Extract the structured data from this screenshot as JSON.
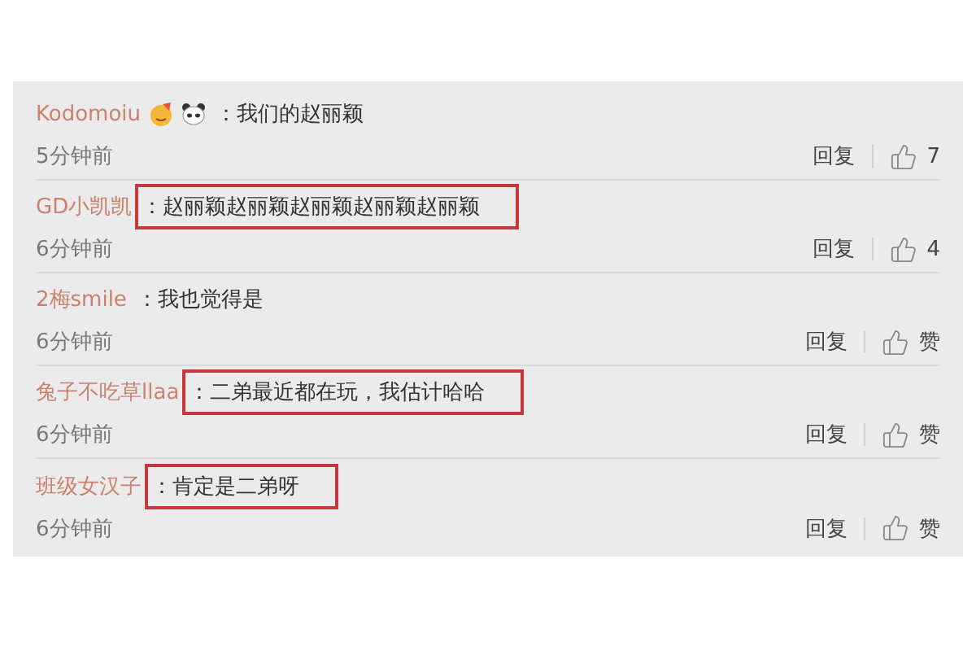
{
  "comments": [
    {
      "user": "Kodomoiu",
      "emoji": [
        {
          "kind": "face"
        },
        {
          "kind": "panda"
        }
      ],
      "text": "：我们的赵丽颖",
      "highlighted": false,
      "time": "5分钟前",
      "reply": "回复",
      "like": "7"
    },
    {
      "user": "GD小凯凯",
      "text": "：赵丽颖赵丽颖赵丽颖赵丽颖赵丽颖",
      "highlighted": true,
      "time": "6分钟前",
      "reply": "回复",
      "like": "4"
    },
    {
      "user": "2梅smile",
      "text": "：我也觉得是",
      "highlighted": false,
      "time": "6分钟前",
      "reply": "回复",
      "like": "赞"
    },
    {
      "user": "兔子不吃草llaa",
      "text": "：二弟最近都在玩，我估计哈哈",
      "highlighted": true,
      "time": "6分钟前",
      "reply": "回复",
      "like": "赞"
    },
    {
      "user": "班级女汉子",
      "text": "：肯定是二弟呀",
      "highlighted": true,
      "time": "6分钟前",
      "reply": "回复",
      "like": "赞"
    }
  ]
}
